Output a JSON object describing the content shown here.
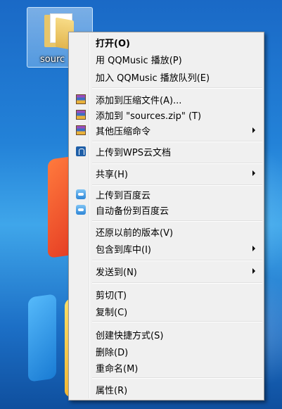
{
  "desktop": {
    "folder": {
      "label": "sourc",
      "icon": "folder-icon"
    }
  },
  "menu": {
    "items": [
      {
        "label": "打开(O)",
        "bold": true,
        "icon": null,
        "submenu": false
      },
      {
        "label": "用 QQMusic 播放(P)",
        "bold": false,
        "icon": null,
        "submenu": false
      },
      {
        "label": "加入 QQMusic 播放队列(E)",
        "bold": false,
        "icon": null,
        "submenu": false
      },
      {
        "label": "添加到压缩文件(A)...",
        "bold": false,
        "icon": "winrar-icon",
        "submenu": false
      },
      {
        "label": "添加到 \"sources.zip\" (T)",
        "bold": false,
        "icon": "winrar-icon",
        "submenu": false
      },
      {
        "label": "其他压缩命令",
        "bold": false,
        "icon": "winrar-icon",
        "submenu": true
      },
      {
        "label": "上传到WPS云文档",
        "bold": false,
        "icon": "wps-cloud-icon",
        "submenu": false
      },
      {
        "label": "共享(H)",
        "bold": false,
        "icon": null,
        "submenu": true
      },
      {
        "label": "上传到百度云",
        "bold": false,
        "icon": "baidu-cloud-icon",
        "submenu": false
      },
      {
        "label": "自动备份到百度云",
        "bold": false,
        "icon": "baidu-cloud-icon",
        "submenu": false
      },
      {
        "label": "还原以前的版本(V)",
        "bold": false,
        "icon": null,
        "submenu": false
      },
      {
        "label": "包含到库中(I)",
        "bold": false,
        "icon": null,
        "submenu": true
      },
      {
        "label": "发送到(N)",
        "bold": false,
        "icon": null,
        "submenu": true
      },
      {
        "label": "剪切(T)",
        "bold": false,
        "icon": null,
        "submenu": false
      },
      {
        "label": "复制(C)",
        "bold": false,
        "icon": null,
        "submenu": false
      },
      {
        "label": "创建快捷方式(S)",
        "bold": false,
        "icon": null,
        "submenu": false
      },
      {
        "label": "删除(D)",
        "bold": false,
        "icon": null,
        "submenu": false
      },
      {
        "label": "重命名(M)",
        "bold": false,
        "icon": null,
        "submenu": false
      },
      {
        "label": "属性(R)",
        "bold": false,
        "icon": null,
        "submenu": false
      }
    ]
  }
}
